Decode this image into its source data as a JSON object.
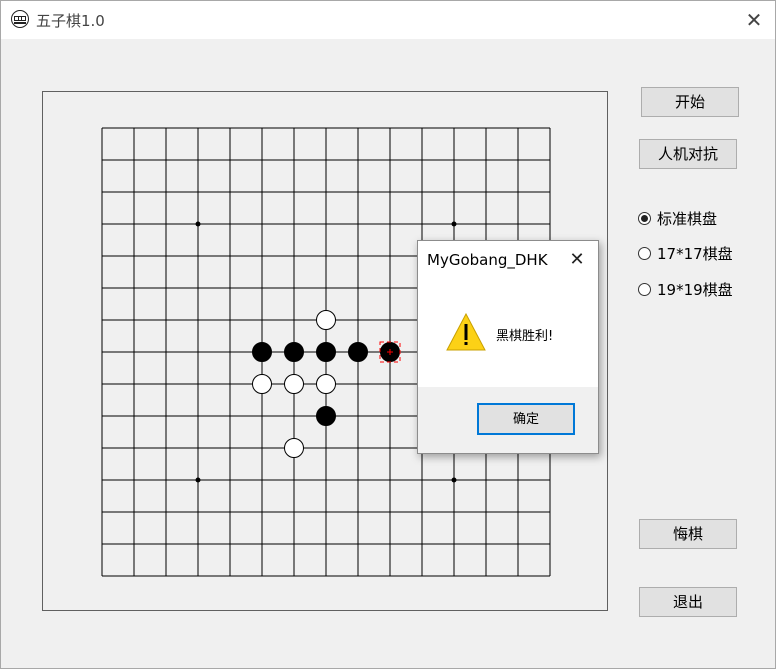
{
  "window": {
    "title": "五子棋1.0",
    "close_glyph": "✕"
  },
  "controls": {
    "start_label": "开始",
    "ai_label": "人机对抗",
    "undo_label": "悔棋",
    "exit_label": "退出",
    "board_options": [
      {
        "label": "标准棋盘",
        "checked": true
      },
      {
        "label": "17*17棋盘",
        "checked": false
      },
      {
        "label": "19*19棋盘",
        "checked": false
      }
    ]
  },
  "board": {
    "lines": 15,
    "star_points": [
      [
        3,
        3
      ],
      [
        11,
        3
      ],
      [
        3,
        11
      ],
      [
        11,
        11
      ]
    ],
    "black_stones": [
      [
        5,
        7
      ],
      [
        6,
        7
      ],
      [
        7,
        7
      ],
      [
        8,
        7
      ],
      [
        9,
        7
      ],
      [
        7,
        9
      ]
    ],
    "white_stones": [
      [
        7,
        6
      ],
      [
        5,
        8
      ],
      [
        6,
        8
      ],
      [
        7,
        8
      ],
      [
        6,
        10
      ]
    ],
    "last_move": [
      9,
      7
    ],
    "colors": {
      "line": "#000000",
      "black": "#000000",
      "white": "#ffffff",
      "marker": "#ff0000"
    }
  },
  "dialog": {
    "title": "MyGobang_DHK",
    "close_glyph": "✕",
    "icon": "warning-icon",
    "message": "黑棋胜利!",
    "ok_label": "确定"
  }
}
